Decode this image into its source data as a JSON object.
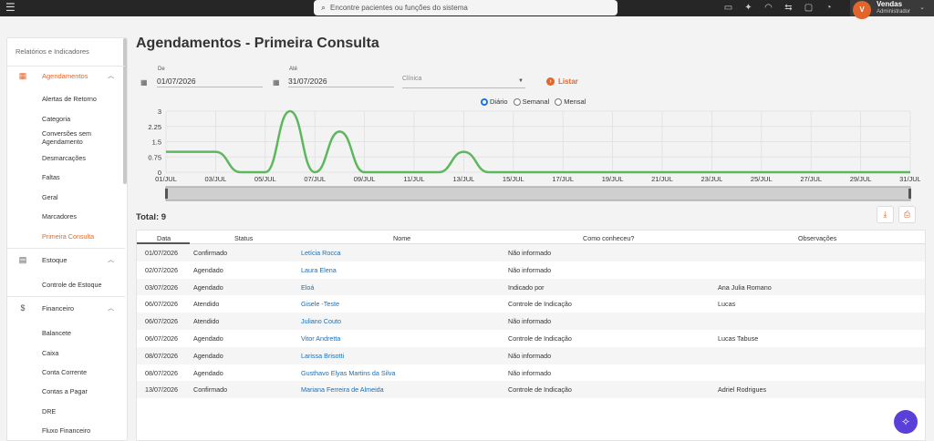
{
  "topbar": {
    "search_placeholder": "Encontre pacientes ou funções do sistema",
    "icons": [
      "video-icon",
      "spark-icon",
      "headset-icon",
      "chat-switch-icon",
      "message-icon",
      "bell-icon"
    ],
    "user": {
      "initial": "V",
      "name": "Vendas",
      "role": "Administrador"
    }
  },
  "sidebar": {
    "title": "Relatórios e Indicadores",
    "sections": [
      {
        "label": "Agendamentos",
        "icon": "calendar-icon",
        "items": [
          "Alertas de Retorno",
          "Categoria",
          "Conversões sem Agendamento",
          "Desmarcações",
          "Faltas",
          "Geral",
          "Marcadores",
          "Primeira Consulta"
        ],
        "active_item": "Primeira Consulta"
      },
      {
        "label": "Estoque",
        "icon": "inventory-icon",
        "items": [
          "Controle de Estoque"
        ]
      },
      {
        "label": "Financeiro",
        "icon": "dollar-icon",
        "items": [
          "Balancete",
          "Caixa",
          "Conta Corrente",
          "Contas a Pagar",
          "DRE",
          "Fluxo Financeiro"
        ]
      }
    ]
  },
  "page": {
    "title": "Agendamentos - Primeira Consulta",
    "from_label": "De",
    "from_value": "01/07/2026",
    "to_label": "Até",
    "to_value": "31/07/2026",
    "clinic_placeholder": "Clínica",
    "list_button": "Listar",
    "period_options": [
      "Diário",
      "Semanal",
      "Mensal"
    ],
    "period_selected": "Diário",
    "total_label": "Total: 9"
  },
  "chart_data": {
    "type": "line",
    "x": [
      "01/JUL",
      "02/JUL",
      "03/JUL",
      "04/JUL",
      "05/JUL",
      "06/JUL",
      "07/JUL",
      "08/JUL",
      "09/JUL",
      "10/JUL",
      "11/JUL",
      "12/JUL",
      "13/JUL",
      "14/JUL",
      "15/JUL",
      "16/JUL",
      "17/JUL",
      "18/JUL",
      "19/JUL",
      "20/JUL",
      "21/JUL",
      "22/JUL",
      "23/JUL",
      "24/JUL",
      "25/JUL",
      "26/JUL",
      "27/JUL",
      "28/JUL",
      "29/JUL",
      "30/JUL",
      "31/JUL"
    ],
    "x_ticks": [
      "01/JUL",
      "03/JUL",
      "05/JUL",
      "07/JUL",
      "09/JUL",
      "11/JUL",
      "13/JUL",
      "15/JUL",
      "17/JUL",
      "19/JUL",
      "21/JUL",
      "23/JUL",
      "25/JUL",
      "27/JUL",
      "29/JUL",
      "31/JUL"
    ],
    "values": [
      1,
      1,
      1,
      0,
      0,
      3,
      0,
      2,
      0,
      0,
      0,
      0,
      1,
      0,
      0,
      0,
      0,
      0,
      0,
      0,
      0,
      0,
      0,
      0,
      0,
      0,
      0,
      0,
      0,
      0,
      0
    ],
    "y_ticks": [
      "3",
      "2.25",
      "1.5",
      "0.75",
      "0"
    ],
    "ylim": [
      0,
      3
    ],
    "color": "#5cb85c",
    "grid": true
  },
  "table": {
    "columns": [
      "Data",
      "Status",
      "Nome",
      "Como conheceu?",
      "Observações"
    ],
    "rows": [
      [
        "01/07/2026",
        "Confirmado",
        "Letícia Rocca",
        "Não informado",
        ""
      ],
      [
        "02/07/2026",
        "Agendado",
        "Laura Elena",
        "Não informado",
        ""
      ],
      [
        "03/07/2026",
        "Agendado",
        "Eloá",
        "Indicado por",
        "Ana Julia Romano"
      ],
      [
        "06/07/2026",
        "Atendido",
        "Gisele -Teste",
        "Controle de Indicação",
        "Lucas"
      ],
      [
        "06/07/2026",
        "Atendido",
        "Juliano Couto",
        "Não informado",
        ""
      ],
      [
        "06/07/2026",
        "Agendado",
        "Vitor Andretta",
        "Controle de Indicação",
        "Lucas Tabuse"
      ],
      [
        "08/07/2026",
        "Agendado",
        "Larissa Brisotti",
        "Não informado",
        ""
      ],
      [
        "08/07/2026",
        "Agendado",
        "Gusthavo Elyas Martins da Silva",
        "Não informado",
        ""
      ],
      [
        "13/07/2026",
        "Confirmado",
        "Mariana Ferreira de Almeida",
        "Controle de Indicação",
        "Adriel Rodrigues"
      ]
    ]
  }
}
